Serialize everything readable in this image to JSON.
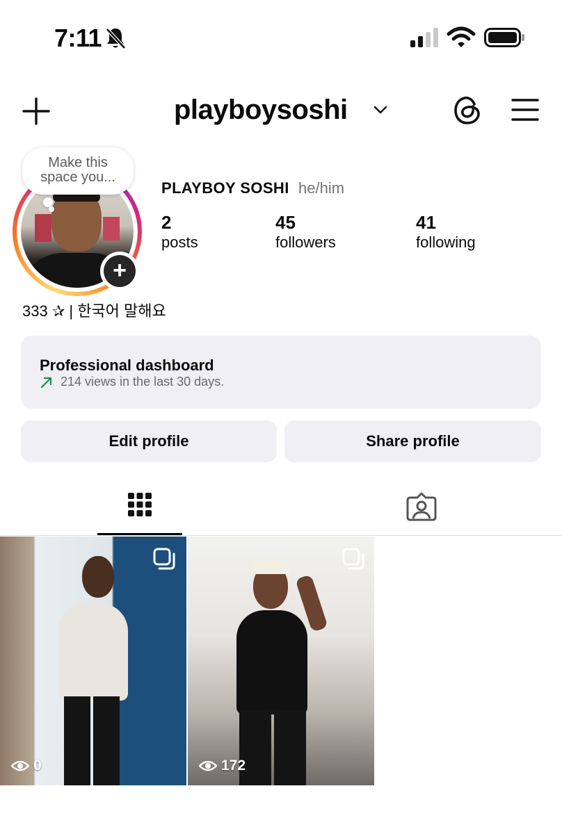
{
  "status_bar": {
    "time": "7:11"
  },
  "header": {
    "username": "playboysoshi"
  },
  "profile": {
    "bubble_text": "Make this space you...",
    "display_name": "PLAYBOY SOSHI",
    "pronouns": "he/him",
    "stats": [
      {
        "value": "2",
        "label": "posts"
      },
      {
        "value": "45",
        "label": "followers"
      },
      {
        "value": "41",
        "label": "following"
      }
    ],
    "bio": "333 ✰ | 한국어 말해요"
  },
  "dashboard": {
    "title": "Professional dashboard",
    "subtitle": "214 views in the last 30 days."
  },
  "buttons": {
    "edit": "Edit profile",
    "share": "Share profile"
  },
  "posts": [
    {
      "views": "0"
    },
    {
      "views": "172"
    }
  ],
  "colors": {
    "accent_green": "#1a8f4c",
    "button_bg": "#efeff4",
    "muted_text": "#737373"
  },
  "icons": [
    "bell-slash-icon",
    "signal-icon",
    "wifi-icon",
    "battery-icon",
    "plus-icon",
    "chevron-down-icon",
    "threads-icon",
    "menu-icon",
    "add-story-icon",
    "trend-arrow-icon",
    "grid-icon",
    "tagged-icon",
    "multi-post-icon",
    "eye-icon"
  ]
}
